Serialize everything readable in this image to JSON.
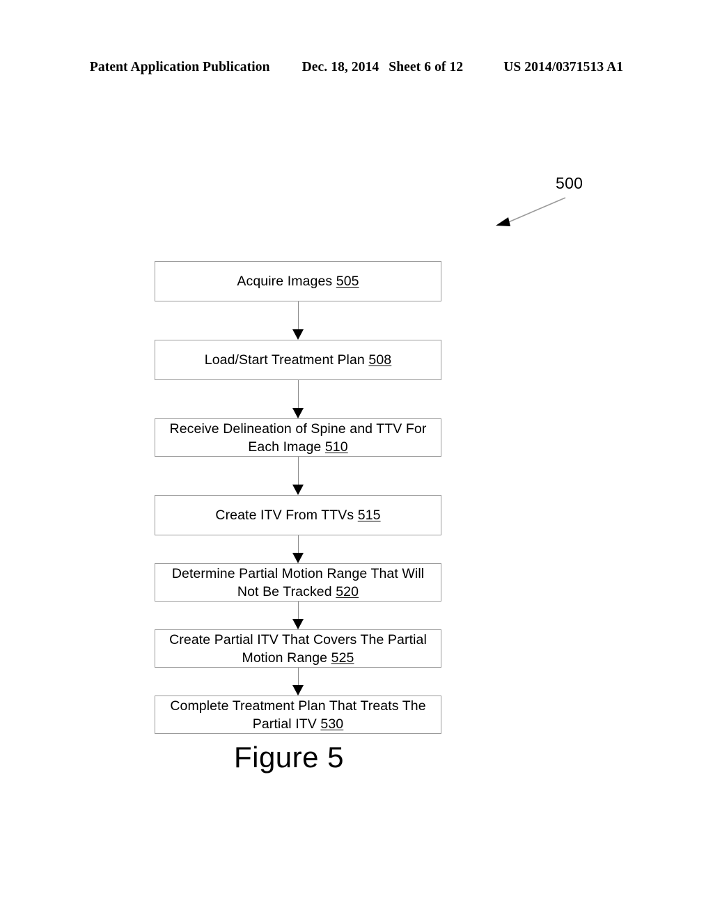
{
  "header": {
    "publication": "Patent Application Publication",
    "date": "Dec. 18, 2014",
    "sheet": "Sheet 6 of 12",
    "patent_number": "US 2014/0371513 A1"
  },
  "figure": {
    "reference_numeral": "500",
    "caption": "Figure 5"
  },
  "flowchart": {
    "type": "flowchart",
    "orientation": "vertical",
    "connector_style": "solid-line-with-filled-arrowhead",
    "nodes": [
      {
        "id": "505",
        "text": "Acquire Images ",
        "num": "505",
        "lines": 1
      },
      {
        "id": "508",
        "text": "Load/Start Treatment Plan ",
        "num": "508",
        "lines": 1
      },
      {
        "id": "510",
        "text": "Receive Delineation of Spine and TTV For Each Image ",
        "num": "510",
        "lines": 2
      },
      {
        "id": "515",
        "text": "Create ITV From TTVs ",
        "num": "515",
        "lines": 1
      },
      {
        "id": "520",
        "text": "Determine Partial Motion Range That Will Not Be Tracked ",
        "num": "520",
        "lines": 2
      },
      {
        "id": "525",
        "text": "Create Partial ITV That Covers The Partial Motion Range ",
        "num": "525",
        "lines": 2
      },
      {
        "id": "530",
        "text": "Complete Treatment Plan That Treats The Partial ITV ",
        "num": "530",
        "lines": 2
      }
    ]
  },
  "colors": {
    "box_border": "#9a9a9a",
    "connector": "#8d8d8d",
    "arrowhead": "#000000",
    "text": "#000000",
    "background": "#ffffff"
  }
}
